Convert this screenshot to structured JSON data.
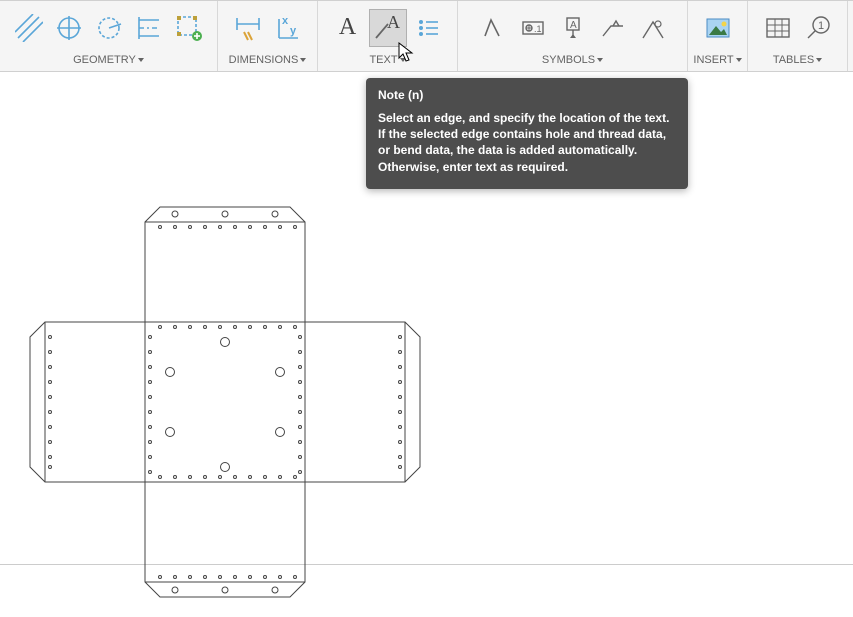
{
  "ribbon": {
    "geometry": {
      "label": "GEOMETRY"
    },
    "dimensions": {
      "label": "DIMENSIONS"
    },
    "text": {
      "label": "TEXT",
      "letter_a": "A"
    },
    "symbols": {
      "label": "SYMBOLS"
    },
    "insert": {
      "label": "INSERT"
    },
    "tables": {
      "label": "TABLES",
      "badge": "1"
    }
  },
  "tooltip": {
    "title": "Note (n)",
    "body": "Select an edge, and specify the location of the text. If the selected edge contains hole and thread data, or bend data, the data is added automatically. Otherwise, enter text as required."
  }
}
